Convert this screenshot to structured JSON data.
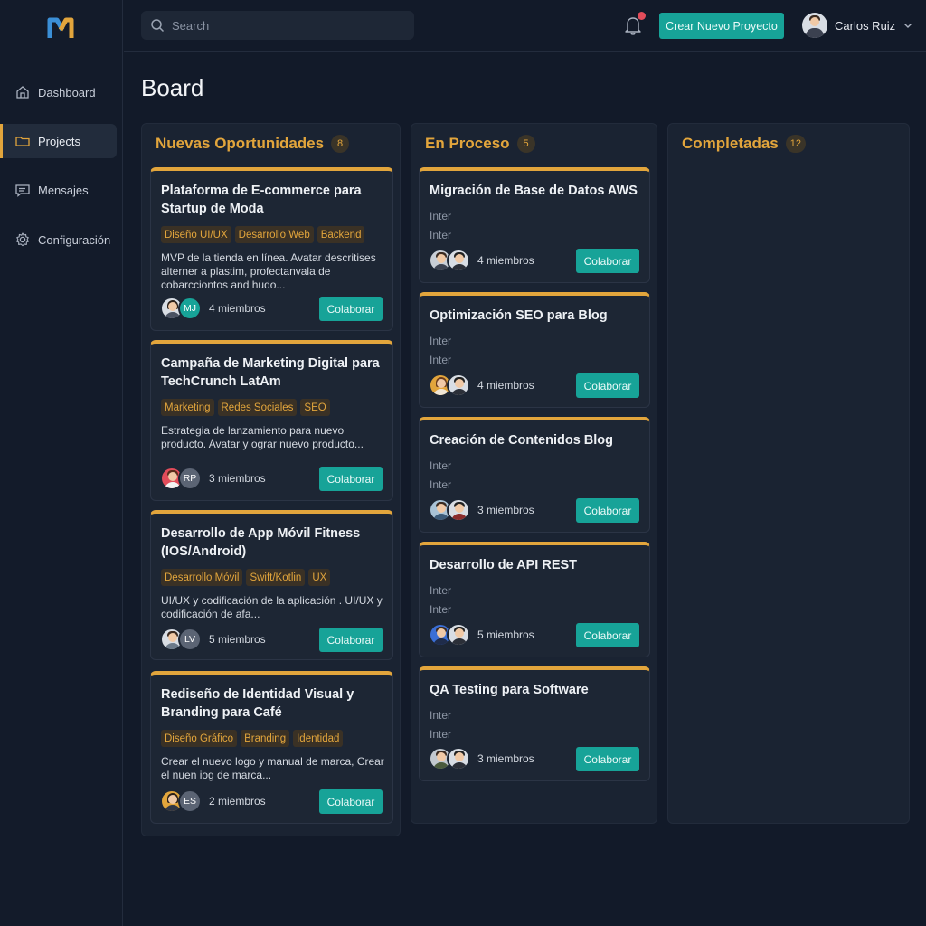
{
  "colors": {
    "accent": "#e2a53c",
    "primary": "#17a398",
    "background": "#121a29",
    "column": "#1a2332",
    "card": "#1d2634"
  },
  "nav": {
    "items": [
      {
        "label": "Dashboard",
        "icon": "home-icon"
      },
      {
        "label": "Projects",
        "icon": "folder-icon",
        "active": true
      },
      {
        "label": "Mensajes",
        "icon": "message-icon"
      },
      {
        "label": "Configuración",
        "icon": "gear-icon"
      }
    ]
  },
  "topbar": {
    "search_placeholder": "Search",
    "cta_label": "Crear Nuevo Proyecto",
    "user_name": "Carlos Ruiz"
  },
  "board": {
    "title": "Board",
    "columns": [
      {
        "title": "Nuevas Oportunidades",
        "count": "8",
        "cards": [
          {
            "title": [
              "Plataforma de E-commerce para",
              "Startup de Moda"
            ],
            "tags": [
              "Diseño UI/UX",
              "Desarrollo Web",
              "Backend"
            ],
            "desc": [
              "MVP de la tienda en línea. Avatar descritises",
              "alterner a plastim, profectanvala de",
              "cobarcciontos and hudo..."
            ],
            "avatars": [
              "photo",
              "MJ"
            ],
            "members": "4 miembros",
            "button": "Colaborar"
          },
          {
            "title": [
              "Campaña de Marketing Digital para",
              "TechCrunch LatAm"
            ],
            "tags": [
              "Marketing",
              "Redes Sociales",
              "SEO"
            ],
            "desc": [
              "Estrategia de lanzamiento para nuevo",
              "producto. Avatar y ograr nuevo producto..."
            ],
            "avatars": [
              "photo",
              "RP"
            ],
            "members": "3 miembros",
            "button": "Colaborar"
          },
          {
            "title": [
              "Desarrollo de App Móvil Fitness",
              "(IOS/Android)"
            ],
            "tags": [
              "Desarrollo Móvil",
              "Swift/Kotlin",
              "UX"
            ],
            "desc": [
              "UI/UX y codificación de la aplicación . UI/UX y",
              "codificación de afa..."
            ],
            "avatars": [
              "photo",
              "LV"
            ],
            "members": "5 miembros",
            "button": "Colaborar"
          },
          {
            "title": [
              "Rediseño de Identidad Visual y",
              "Branding para Café"
            ],
            "tags": [
              "Diseño Gráfico",
              "Branding",
              "Identidad"
            ],
            "desc": [
              "Crear el nuevo logo y manual de marca, Crear",
              "el nuen iog de marca..."
            ],
            "avatars": [
              "photo",
              "ES"
            ],
            "members": "2 miembros",
            "button": "Colaborar"
          }
        ]
      },
      {
        "title": "En Proceso",
        "count": "5",
        "cards": [
          {
            "title": [
              "Migración de Base de Datos AWS"
            ],
            "meta": [
              "Inter",
              "Inter"
            ],
            "members": "4 miembros",
            "button": "Colaborar"
          },
          {
            "title": [
              "Optimización SEO para Blog"
            ],
            "meta": [
              "Inter",
              "Inter"
            ],
            "members": "4 miembros",
            "button": "Colaborar"
          },
          {
            "title": [
              "Creación de Contenidos Blog"
            ],
            "meta": [
              "Inter",
              "Inter"
            ],
            "members": "3 miembros",
            "button": "Colaborar"
          },
          {
            "title": [
              "Desarrollo de API REST"
            ],
            "meta": [
              "Inter",
              "Inter"
            ],
            "members": "5 miembros",
            "button": "Colaborar"
          },
          {
            "title": [
              "QA Testing para Software"
            ],
            "meta": [
              "Inter",
              "Inter"
            ],
            "members": "3 miembros",
            "button": "Colaborar"
          }
        ]
      },
      {
        "title": "Completadas",
        "count": "12",
        "cards": []
      }
    ]
  }
}
